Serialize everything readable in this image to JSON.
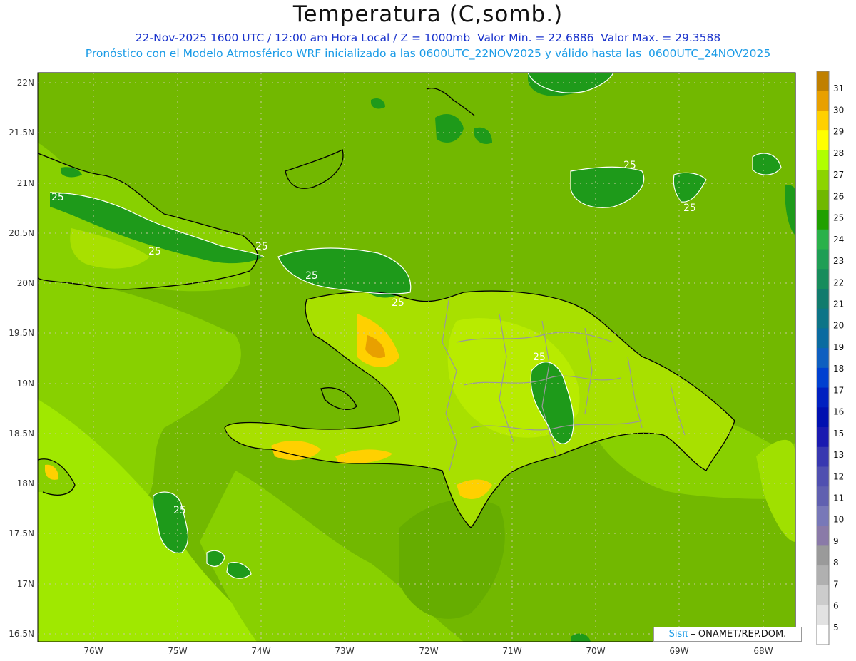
{
  "header": {
    "title": "Temperatura (C,somb.)",
    "line1": "22-Nov-2025 1600 UTC / 12:00 am Hora Local / Z = 1000mb  Valor Min. = 22.6886  Valor Max. = 29.3588",
    "line2": "Pronóstico con el Modelo Atmosférico WRF inicializado a las 0600UTC_22NOV2025 y válido hasta las  0600UTC_24NOV2025"
  },
  "map": {
    "lat_labels": [
      "22N",
      "21.5N",
      "21N",
      "20.5N",
      "20N",
      "19.5N",
      "19N",
      "18.5N",
      "18N",
      "17.5N",
      "17N",
      "16.5N"
    ],
    "lon_labels": [
      "76W",
      "75W",
      "74W",
      "73W",
      "72W",
      "71W",
      "70W",
      "69W",
      "68W"
    ],
    "contour_labels": [
      "25",
      "25",
      "25",
      "25",
      "25",
      "25",
      "25",
      "25",
      "25",
      "25"
    ],
    "colors": {
      "ocean": "#72b800",
      "land_warm": "#a8e000",
      "cool": "#1e9a1a",
      "hot": "#f0c000"
    }
  },
  "colorbar": {
    "labels": [
      "31",
      "30",
      "29",
      "28",
      "27",
      "26",
      "25",
      "24",
      "23",
      "22",
      "21",
      "20",
      "19",
      "18",
      "17",
      "16",
      "15",
      "13",
      "12",
      "11",
      "10",
      "9",
      "8",
      "7",
      "6",
      "5"
    ],
    "colors": [
      "#c08000",
      "#e8a000",
      "#ffd000",
      "#ffff00",
      "#b0ff00",
      "#8cd400",
      "#70b800",
      "#20a000",
      "#2ab14a",
      "#1f9e55",
      "#178c5c",
      "#117b6d",
      "#0d7487",
      "#0a6ba0",
      "#0e5fc0",
      "#0040d0",
      "#0020c0",
      "#0010b0",
      "#1a1ab0",
      "#3838b0",
      "#5050b0",
      "#6060b0",
      "#7878b8",
      "#8a7aa8",
      "#9a9a9a",
      "#b0b0b0",
      "#cccccc",
      "#e2e2e2",
      "#ffffff"
    ]
  },
  "credit": {
    "logo": "Sisπ",
    "text": "– ONAMET/REP.DOM."
  }
}
